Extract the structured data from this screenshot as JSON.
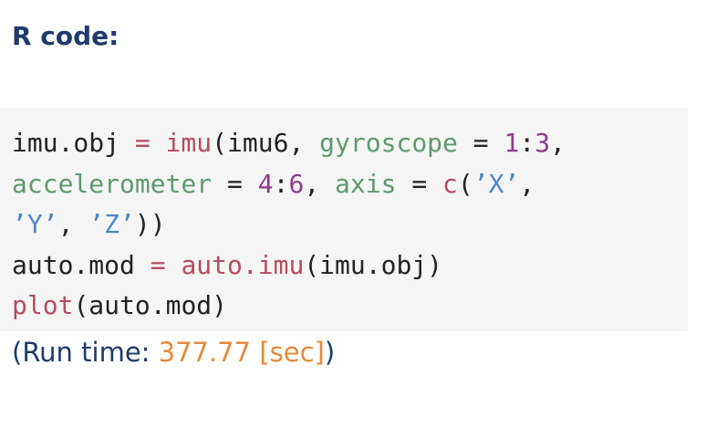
{
  "heading": "R code:",
  "code_lines": [
    [
      {
        "t": "imu.obj ",
        "c": "plain"
      },
      {
        "t": "=",
        "c": "op"
      },
      {
        "t": " ",
        "c": "plain"
      },
      {
        "t": "imu",
        "c": "fn"
      },
      {
        "t": "(imu6, ",
        "c": "plain"
      },
      {
        "t": "gyroscope",
        "c": "arg"
      },
      {
        "t": " = ",
        "c": "plain"
      },
      {
        "t": "1",
        "c": "num"
      },
      {
        "t": ":",
        "c": "plain"
      },
      {
        "t": "3",
        "c": "num"
      },
      {
        "t": ",",
        "c": "plain"
      }
    ],
    [
      {
        "t": "accelerometer",
        "c": "arg"
      },
      {
        "t": " = ",
        "c": "plain"
      },
      {
        "t": "4",
        "c": "num"
      },
      {
        "t": ":",
        "c": "plain"
      },
      {
        "t": "6",
        "c": "num"
      },
      {
        "t": ", ",
        "c": "plain"
      },
      {
        "t": "axis",
        "c": "arg"
      },
      {
        "t": " = ",
        "c": "plain"
      },
      {
        "t": "c",
        "c": "fn"
      },
      {
        "t": "(",
        "c": "plain"
      },
      {
        "t": "’X’",
        "c": "str"
      },
      {
        "t": ",",
        "c": "plain"
      }
    ],
    [
      {
        "t": "’Y’",
        "c": "str"
      },
      {
        "t": ", ",
        "c": "plain"
      },
      {
        "t": "’Z’",
        "c": "str"
      },
      {
        "t": "))",
        "c": "plain"
      }
    ],
    [
      {
        "t": "auto.mod ",
        "c": "plain"
      },
      {
        "t": "=",
        "c": "op"
      },
      {
        "t": " ",
        "c": "plain"
      },
      {
        "t": "auto.imu",
        "c": "fn"
      },
      {
        "t": "(imu.obj)",
        "c": "plain"
      }
    ],
    [
      {
        "t": "plot",
        "c": "fn"
      },
      {
        "t": "(auto.mod)",
        "c": "plain"
      }
    ]
  ],
  "runtime": {
    "prefix": "(Run time: ",
    "value": "377.77 [sec]",
    "suffix": ")"
  },
  "colors": {
    "heading": "#1f3a6b",
    "code_background": "#f5f5f5",
    "operator_function": "#b84a5e",
    "argument_name": "#5d9a6b",
    "number": "#8e3b8e",
    "string": "#4a86c8",
    "runtime_value": "#e58a3b"
  }
}
